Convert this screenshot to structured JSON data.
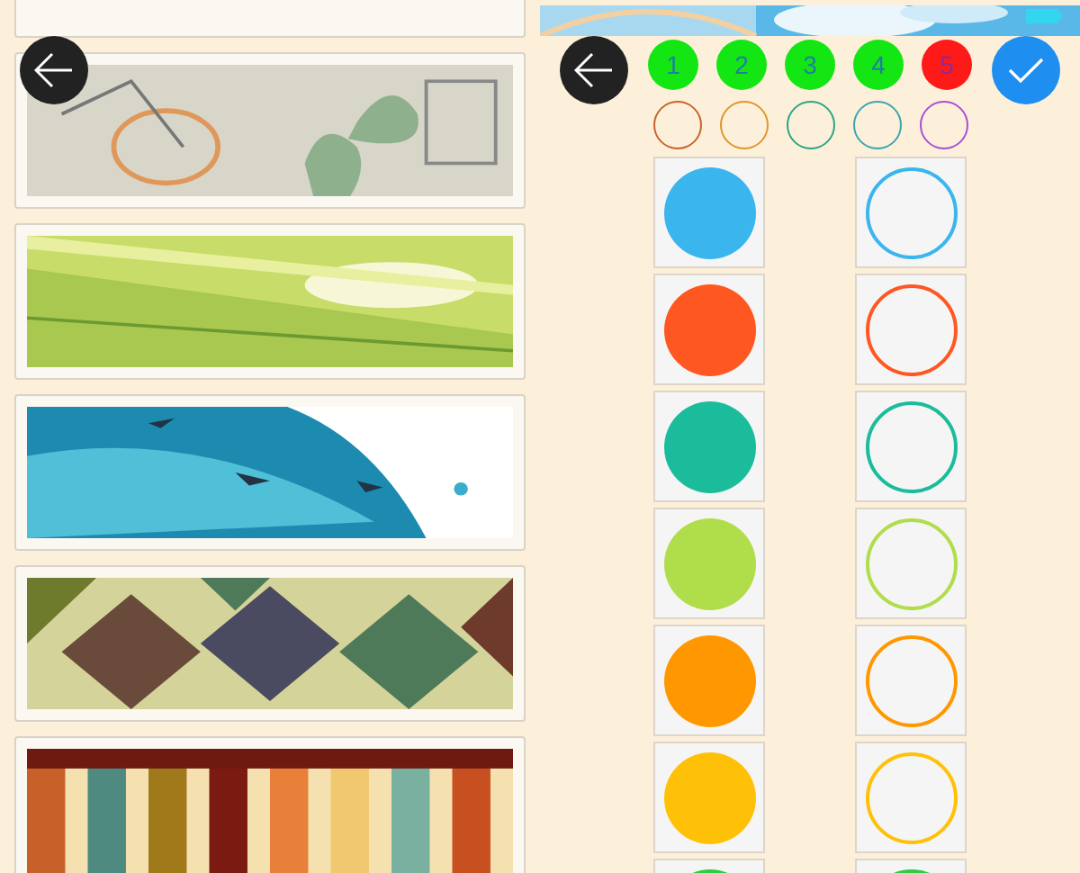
{
  "patterns": [
    {
      "kind": "card"
    },
    {
      "kind": "picture"
    },
    {
      "kind": "picture"
    },
    {
      "kind": "picture"
    },
    {
      "kind": "picture"
    },
    {
      "kind": "picture"
    }
  ],
  "steps": [
    {
      "label": "1",
      "selected": false
    },
    {
      "label": "2",
      "selected": false
    },
    {
      "label": "3",
      "selected": false
    },
    {
      "label": "4",
      "selected": false
    },
    {
      "label": "5",
      "selected": true
    }
  ],
  "swatches": [
    {
      "color": "#c8642a"
    },
    {
      "color": "#e0952e"
    },
    {
      "color": "#2aa585"
    },
    {
      "color": "#3aa5b0"
    },
    {
      "color": "#a64fd6"
    }
  ],
  "colors": [
    {
      "color": "#3bb5ed"
    },
    {
      "color": "#ff5722"
    },
    {
      "color": "#1abc9c"
    },
    {
      "color": "#b0dd4a"
    },
    {
      "color": "#ff9800"
    },
    {
      "color": "#ffc107"
    },
    {
      "color": "#2ecc40"
    }
  ]
}
